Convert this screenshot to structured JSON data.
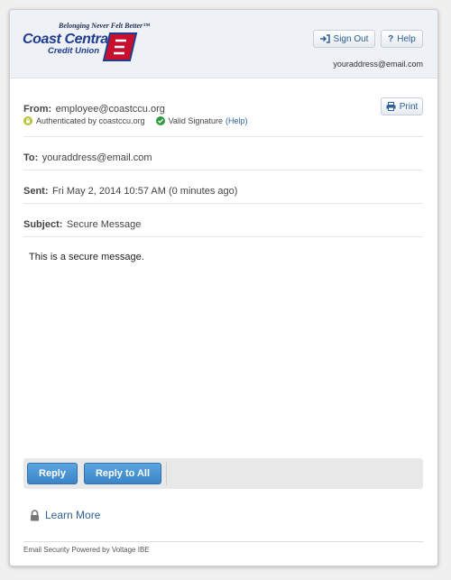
{
  "logo": {
    "tagline": "Belonging Never Felt Better™",
    "name_line1": "Coast Central",
    "name_line2": "Credit Union",
    "brand_colors": {
      "navy": "#1f3d8f",
      "red": "#c8102e"
    }
  },
  "header": {
    "signout_label": "Sign Out",
    "help_label": "Help",
    "user_email": "youraddress@email.com",
    "icons": {
      "signout": "sign-out-icon",
      "help": "question-mark-icon"
    }
  },
  "message": {
    "from_label": "From:",
    "from_value": "employee@coastccu.org",
    "authenticated_text": "Authenticated by coastccu.org",
    "valid_signature_text": "Valid Signature",
    "valid_signature_help": "(Help)",
    "print_label": "Print",
    "to_label": "To:",
    "to_value": "youraddress@email.com",
    "sent_label": "Sent:",
    "sent_value": "Fri May 2, 2014 10:57 AM (0 minutes ago)",
    "subject_label": "Subject:",
    "subject_value": "Secure Message",
    "body": "This is a secure message.",
    "status_colors": {
      "authenticated": "#b8c23a",
      "valid": "#2d9c3c"
    }
  },
  "actions": {
    "reply_label": "Reply",
    "reply_all_label": "Reply to All",
    "accent": "#3b84c8"
  },
  "learn_more": {
    "label": "Learn More",
    "icon": "lock-icon"
  },
  "footer": {
    "text": "Email Security Powered by Voltage IBE"
  }
}
